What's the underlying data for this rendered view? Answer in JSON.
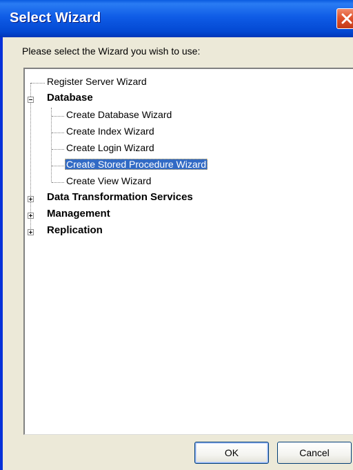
{
  "window": {
    "title": "Select Wizard"
  },
  "prompt": "Please select the Wizard you wish to use:",
  "tree": {
    "items": [
      {
        "label": "Register Server Wizard",
        "level": 0,
        "bold": false
      },
      {
        "label": "Database",
        "level": 0,
        "bold": true,
        "expanded": true
      },
      {
        "label": "Create Database Wizard",
        "level": 1,
        "bold": false
      },
      {
        "label": "Create Index Wizard",
        "level": 1,
        "bold": false
      },
      {
        "label": "Create Login Wizard",
        "level": 1,
        "bold": false
      },
      {
        "label": "Create Stored Procedure Wizard",
        "level": 1,
        "bold": false,
        "selected": true
      },
      {
        "label": "Create View Wizard",
        "level": 1,
        "bold": false
      },
      {
        "label": "Data Transformation Services",
        "level": 0,
        "bold": true,
        "expanded": false
      },
      {
        "label": "Management",
        "level": 0,
        "bold": true,
        "expanded": false
      },
      {
        "label": "Replication",
        "level": 0,
        "bold": true,
        "expanded": false
      }
    ]
  },
  "buttons": {
    "ok": "OK",
    "cancel": "Cancel"
  },
  "colors": {
    "titlebar": "#0348d2",
    "selection": "#316ac5",
    "close": "#e0532d"
  }
}
